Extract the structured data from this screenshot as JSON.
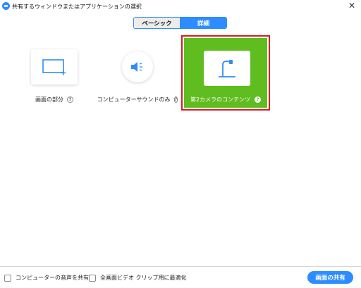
{
  "window": {
    "title": "共有するウィンドウまたはアプリケーションの選択",
    "close_glyph": "✕"
  },
  "tabs": {
    "basic": "ベーシック",
    "advanced": "詳細",
    "selected": "advanced"
  },
  "options": {
    "portion": {
      "label": "画面の部分",
      "icon": "portion-rectangle-icon"
    },
    "computer_audio": {
      "label": "コンピューターサウンドのみ",
      "icon": "speaker-icon"
    },
    "camera": {
      "label": "第2カメラのコンテンツ",
      "icon": "document-camera-icon",
      "selected": true
    }
  },
  "help_glyph": "?",
  "footer": {
    "share_audio_label": "コンピューターの音声を共有",
    "optimize_video_label": "全画面ビデオ クリップ用に最適化",
    "share_button": "画面の共有"
  },
  "colors": {
    "accent": "#2d8cff",
    "selected_bg": "#5fbd1f",
    "selected_border": "#d41f1f"
  }
}
